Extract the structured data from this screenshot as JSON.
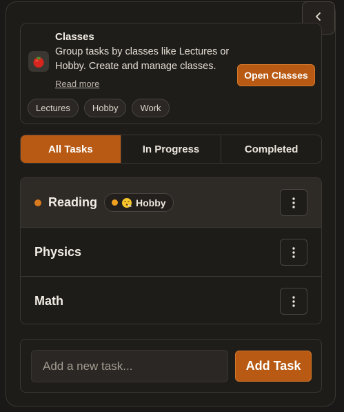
{
  "header": {
    "collapse_icon": "chevron-left-icon"
  },
  "classes_card": {
    "icon": "tomato-icon",
    "title": "Classes",
    "description": "Group tasks by classes like Lectures or Hobby. Create and manage classes.",
    "read_more": "Read more",
    "open_button": "Open Classes",
    "chips": [
      "Lectures",
      "Hobby",
      "Work"
    ]
  },
  "tabs": [
    {
      "label": "All Tasks",
      "active": true
    },
    {
      "label": "In Progress",
      "active": false
    },
    {
      "label": "Completed",
      "active": false
    }
  ],
  "tasks": [
    {
      "name": "Reading",
      "selected": true,
      "has_dot": true,
      "class": {
        "label": "Hobby",
        "emoji": "exhaling-face-emoji"
      }
    },
    {
      "name": "Physics",
      "selected": false,
      "has_dot": false,
      "class": null
    },
    {
      "name": "Math",
      "selected": false,
      "has_dot": false,
      "class": null
    }
  ],
  "add_task": {
    "placeholder": "Add a new task...",
    "button": "Add Task"
  },
  "colors": {
    "accent": "#b85a14",
    "background": "#1b1917",
    "dot": "#d97a1e"
  }
}
